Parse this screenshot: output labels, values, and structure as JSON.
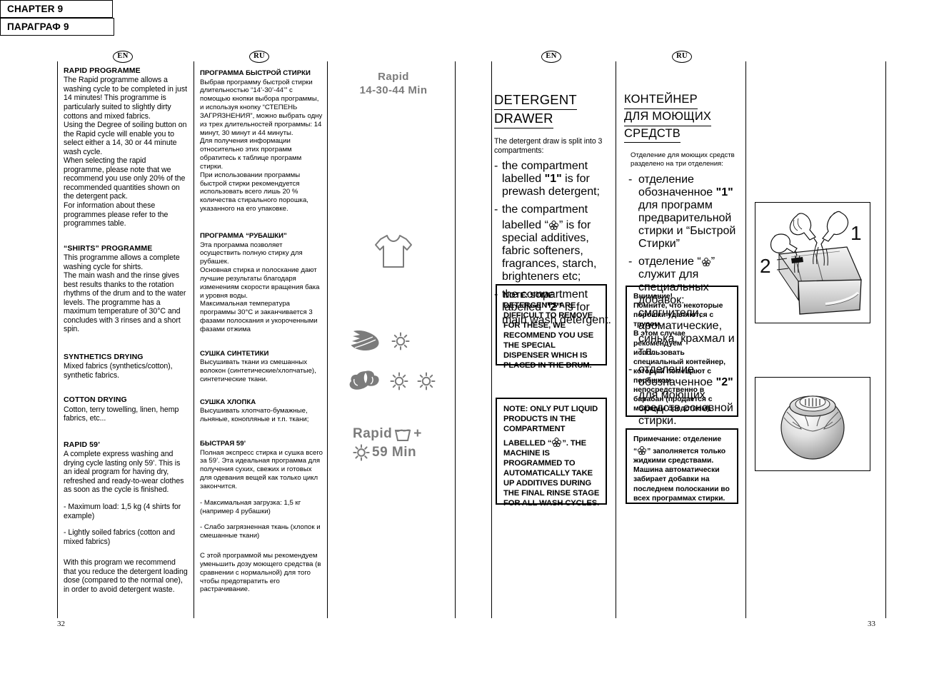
{
  "spread": {
    "left_page_number": "32",
    "right_page_number": "33",
    "lang_badge_en": "EN",
    "lang_badge_ru": "RU",
    "icon_color": "#7b7b7b"
  },
  "left_page": {
    "en": {
      "sections": [
        {
          "heading": "RAPID PROGRAMME",
          "body": "The Rapid programme allows a washing cycle to be completed in just 14 minutes! This programme is particularly suited to slightly dirty cottons and mixed fabrics.\nUsing the Degree of soiling button on the Rapid cycle will enable you to select either a 14, 30 or 44 minute wash cycle.\nWhen selecting the rapid programme, please note that we recommend you use only 20% of the recommended quantities shown on the detergent pack.\nFor information about these programmes please refer to the programmes table."
        },
        {
          "heading": "“SHIRTS” PROGRAMME",
          "body": "This programme allows a complete washing cycle for shirts.\nThe main wash and the rinse gives best results thanks to the rotation rhythms of the drum and to the water levels. The programme has a maximum temperature of 30°C and concludes with 3 rinses and a short spin."
        },
        {
          "heading": "SYNTHETICS DRYING",
          "body": "Mixed fabrics (synthetics/cotton), synthetic fabrics."
        },
        {
          "heading": "COTTON DRYING",
          "body": "Cotton, terry towelling, linen, hemp fabrics, etc..."
        },
        {
          "heading": "RAPID  59’",
          "body": "A complete express washing and drying cycle lasting only 59’. This is an ideal program for having  dry, refreshed and ready-to-wear clothes as soon as the cycle is finished."
        }
      ],
      "rapid59_bullets": [
        "- Maximum load: 1,5 kg (4 shirts for example)",
        "- Lightly soiled fabrics (cotton and mixed fabrics)"
      ],
      "rapid59_tail": "With this program we recommend that you reduce the detergent loading dose (compared to the normal one), in order to avoid detergent waste."
    },
    "ru": {
      "sections": [
        {
          "heading": "ПРОГРАММА БЫСТРОЙ СТИРКИ",
          "body": "Выбрав программу быстрой стирки длительностью “14’-30’-44’” с помощью кнопки выбора программы, и используя кнопку “СТЕПЕНЬ ЗАГРЯЗНЕНИЯ”, можно выбрать одну из трех длительностей программы: 14 минут, 30 минут и 44 минуты.\nДля получения информации относительно этих программ обратитесь к таблице программ стирки.\nПри использовании программы быстрой стирки рекомендуется использовать всего лишь 20 % количества стирального порошка, указанного на его упаковке."
        },
        {
          "heading": "ПРОГРАММА “РУБАШКИ”",
          "body": "Эта программа позволяет осуществить полную стирку для рубашек.\nОсновная стирка и полоскание дают лучшие результаты благодаря изменениям скорости вращения бака и уровня воды.\nМаксимальная температура программы 30°C и заканчивается 3 фазами полоскания и укороченными фазами отжима"
        },
        {
          "heading": "СУШКА СИНТЕТИКИ",
          "body": "Высушивать ткани из смешанных волокон (синтетические/хлопчатые), синтетические ткани."
        },
        {
          "heading": "СУШКА ХЛОПКА",
          "body": "Высушивать хлопчато-бумажные, льняные, конопляные и т.п. ткани;"
        },
        {
          "heading": "БЫСТРАЯ  59’",
          "body": "Полная экспресс стирка и сушка всего за 59’. Эта идеальная программа для получения сухих, свежих и готовых для одевания вещей как только цикл закончится."
        }
      ],
      "rapid59_bullets": [
        "- Максимальная загрузка: 1,5 кг (например 4 рубашки)",
        "- Слабо загрязненная ткань (хлопок и смешанные ткани)"
      ],
      "rapid59_tail": "С этой программой мы рекомендуем уменьшить дозу моющего средства (в сравнении с нормальной) для того чтобы предотвратить его растрачивание."
    },
    "icons": {
      "rapid_line1": "Rapid",
      "rapid_line2": "14-30-44 Min",
      "shirt_icon": "tshirt-icon",
      "synthetics_icon": "feather-icon",
      "synthetics_suns": 1,
      "cotton_icon": "cotton-boll-icon",
      "cotton_suns": 2,
      "rapid59_word": "Rapid",
      "rapid59_plus": "+",
      "rapid59_minutes": "59 Min",
      "wash_tub_icon": "wash-tub-icon",
      "sun_icon": "sun-icon"
    }
  },
  "right_page": {
    "en": {
      "chapter": "CHAPTER 9",
      "title_line1": "DETERGENT",
      "title_line2": "DRAWER",
      "intro": "The detergent draw is split into 3 compartments:",
      "bullets": [
        {
          "pre": "the compartment labelled ",
          "bold": "\"1\"",
          "post": " is for prewash detergent;"
        },
        {
          "pre": "the compartment",
          "bold": "",
          "post": ""
        },
        {
          "pre": "the compartment labelled ",
          "bold": "\"2\"",
          "post": " is for main wash detergent."
        }
      ],
      "bullet2_detail_pre": "labelled “",
      "bullet2_detail_post": "” is for special additives, fabric softeners, fragrances, starch, brighteners etc;",
      "note1": "NOTE: SOME DETERGENTS ARE DIFFICULT TO REMOVE. FOR THESE, WE RECOMMEND YOU USE THE SPECIAL DISPENSER WHICH IS PLACED IN THE DRUM.",
      "note2_line1": "NOTE: ONLY PUT LIQUID PRODUCTS IN THE COMPARTMENT",
      "note2_label_pre": "LABELLED “",
      "note2_label_post": "”. THE MACHINE IS PROGRAMMED TO AUTOMATICALLY TAKE UP ADDITIVES DURING THE FINAL RINSE STAGE FOR ALL WASH CYCLES."
    },
    "ru": {
      "chapter": "ПАРАГРАФ 9",
      "title_line1": "КОНТЕЙНЕР",
      "title_line2": "ДЛЯ МОЮЩИХ ",
      "title_line3": "СРЕДСТВ",
      "intro": "Отделение для моющих средств разделено на три отделения:",
      "bullet1_pre": "отделение обозначенное ",
      "bullet1_bold": "\"1\"",
      "bullet1_post": " для программ предварительной стирки и “Быстрой Стирки”",
      "bullet2_pre": "отделение “",
      "bullet2_post": "” служит для специальных добавок: смягчители, ароматические, синька, крахмал и т.п.",
      "bullet3_pre": "отделение обозначенное ",
      "bullet3_bold": "\"2\"",
      "bullet3_post": " для моющих средств основной стирки.",
      "note1": "Внимание!\nПомните, что некоторые порошки удаляются с трудом.\nВ этом случае рекомендуем использовать специальный контейнер, который помещают с  порошком непосредственно в барабан (продается с моющим средством).",
      "note2_line1": "Примечание: отделение",
      "note2_pre": "“",
      "note2_post": "” заполняется только жидкими средствами. Машина автоматически забирает добавки на последнем полоскании во всех программах стирки."
    },
    "illustrations": {
      "drawer": {
        "name": "detergent-drawer-illustration",
        "label_left": "2",
        "label_right": "1",
        "flower_symbol": "flower-icon"
      },
      "ball": {
        "name": "dispenser-ball-illustration"
      }
    }
  }
}
